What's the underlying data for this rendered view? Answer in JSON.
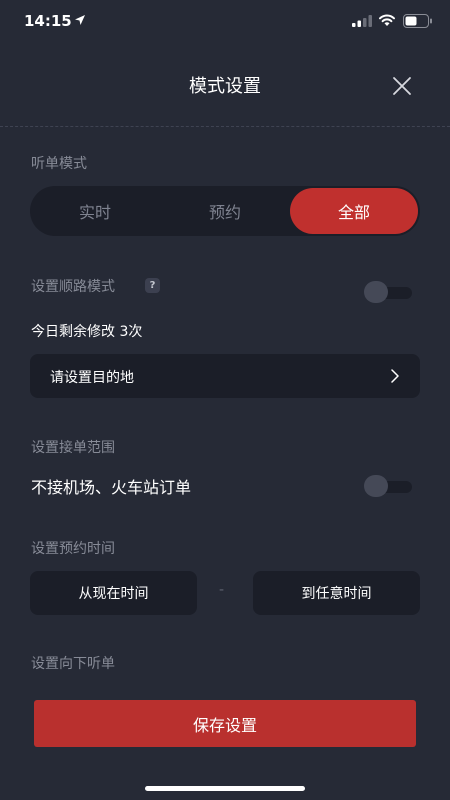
{
  "status_bar": {
    "time": "14:15",
    "icons": [
      "location-arrow-icon",
      "signal-icon",
      "wifi-icon",
      "battery-icon"
    ]
  },
  "header": {
    "title": "模式设置",
    "close_icon": "close-icon"
  },
  "listen_mode": {
    "label": "听单模式",
    "options": [
      "实时",
      "预约",
      "全部"
    ],
    "selected": "全部"
  },
  "route_mode": {
    "label": "设置顺路模式",
    "help_badge": "?",
    "toggle_on": false,
    "remaining_text": "今日剩余修改 3次",
    "destination_placeholder": "请设置目的地",
    "chevron_icon": "chevron-right-icon"
  },
  "order_range": {
    "label": "设置接单范围",
    "option_text": "不接机场、火车站订单",
    "toggle_on": false
  },
  "booking_time": {
    "label": "设置预约时间",
    "start": "从现在时间",
    "separator": "-",
    "end": "到任意时间"
  },
  "downward": {
    "label": "设置向下听单"
  },
  "save_button": {
    "label": "保存设置"
  },
  "colors": {
    "background": "#262a36",
    "panel": "#1b1e28",
    "accent": "#c0302e",
    "muted_text": "#878b97"
  }
}
